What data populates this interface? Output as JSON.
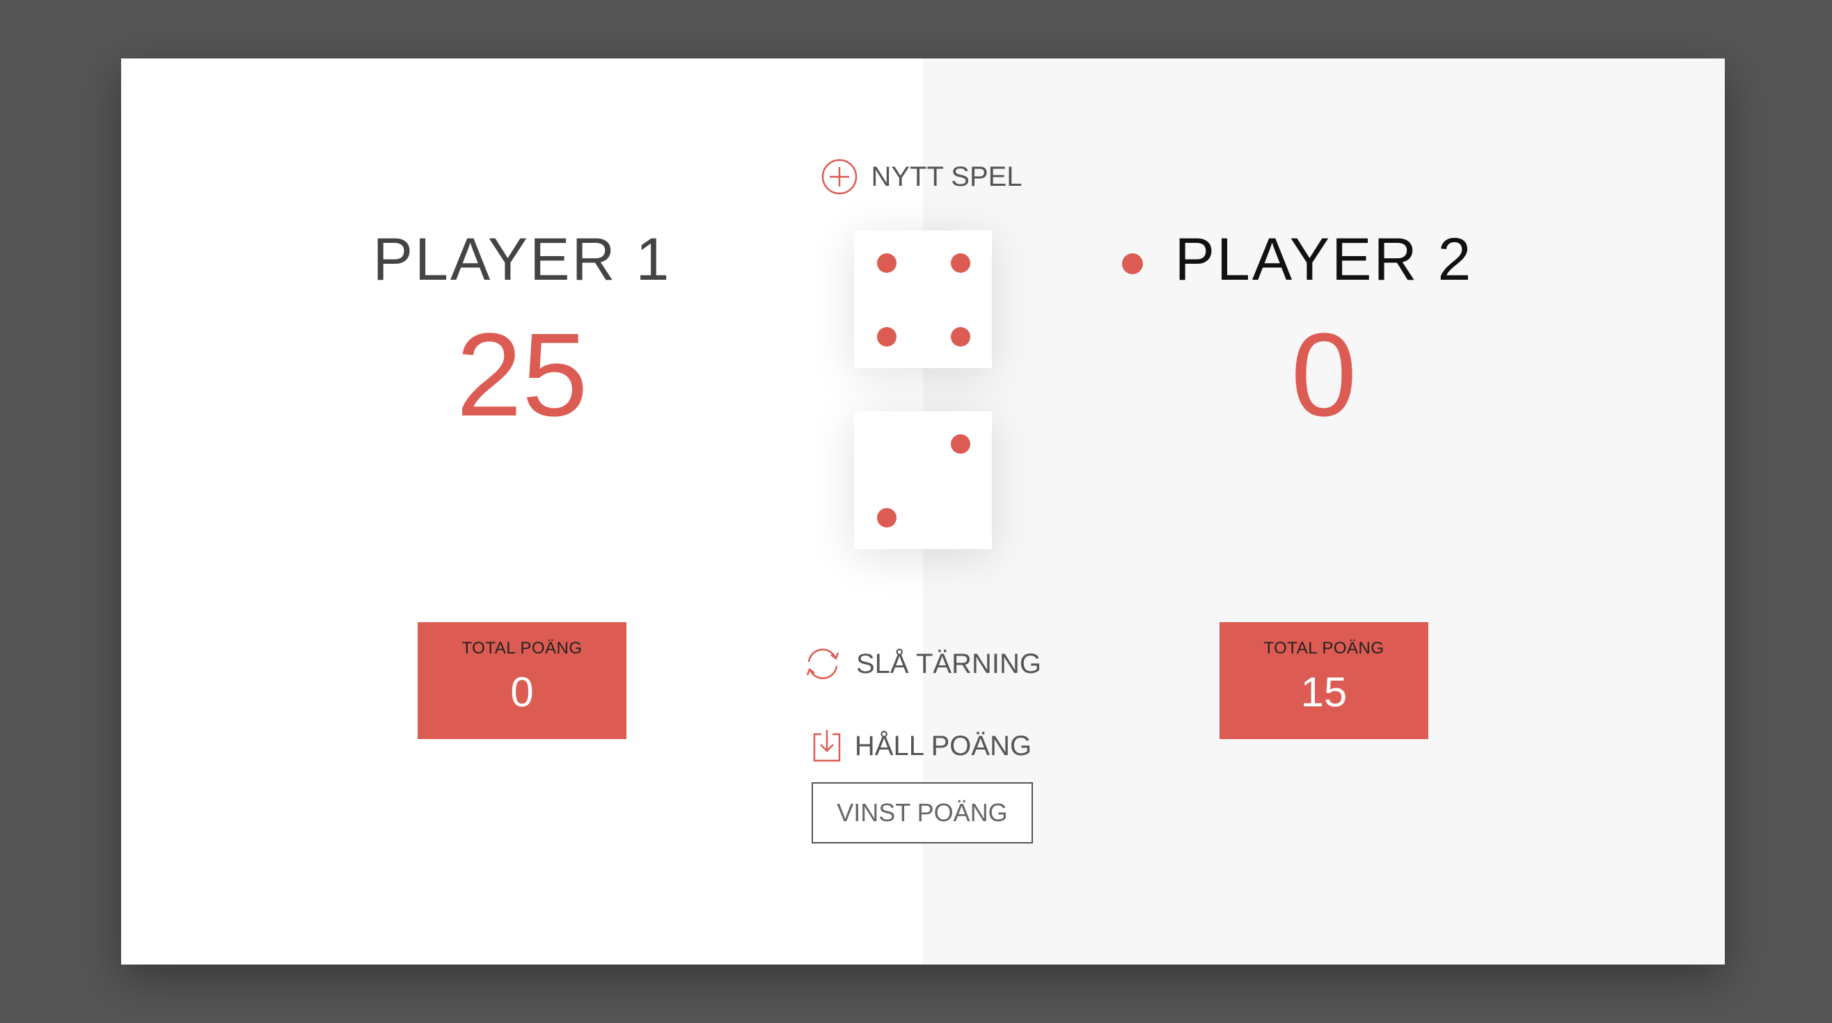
{
  "controls": {
    "new_game_label": "NYTT SPEL",
    "roll_label": "SLÅ TÄRNING",
    "hold_label": "HÅLL POÄNG",
    "target_placeholder": "VINST POÄNG"
  },
  "players": [
    {
      "name": "PLAYER 1",
      "score": "25",
      "current_label": "TOTAL POÄNG",
      "current_value": "0",
      "active": false
    },
    {
      "name": "PLAYER 2",
      "score": "0",
      "current_label": "TOTAL POÄNG",
      "current_value": "15",
      "active": true
    }
  ],
  "dice": [
    {
      "value": 4
    },
    {
      "value": 2
    }
  ],
  "colors": {
    "accent": "#dc5b52",
    "background": "#555555",
    "panel_light": "#ffffff",
    "panel_active": "#f7f7f7"
  },
  "icons": {
    "new_game": "plus-circle-icon",
    "roll": "refresh-icon",
    "hold": "download-icon",
    "active_player": "active-dot-icon"
  }
}
